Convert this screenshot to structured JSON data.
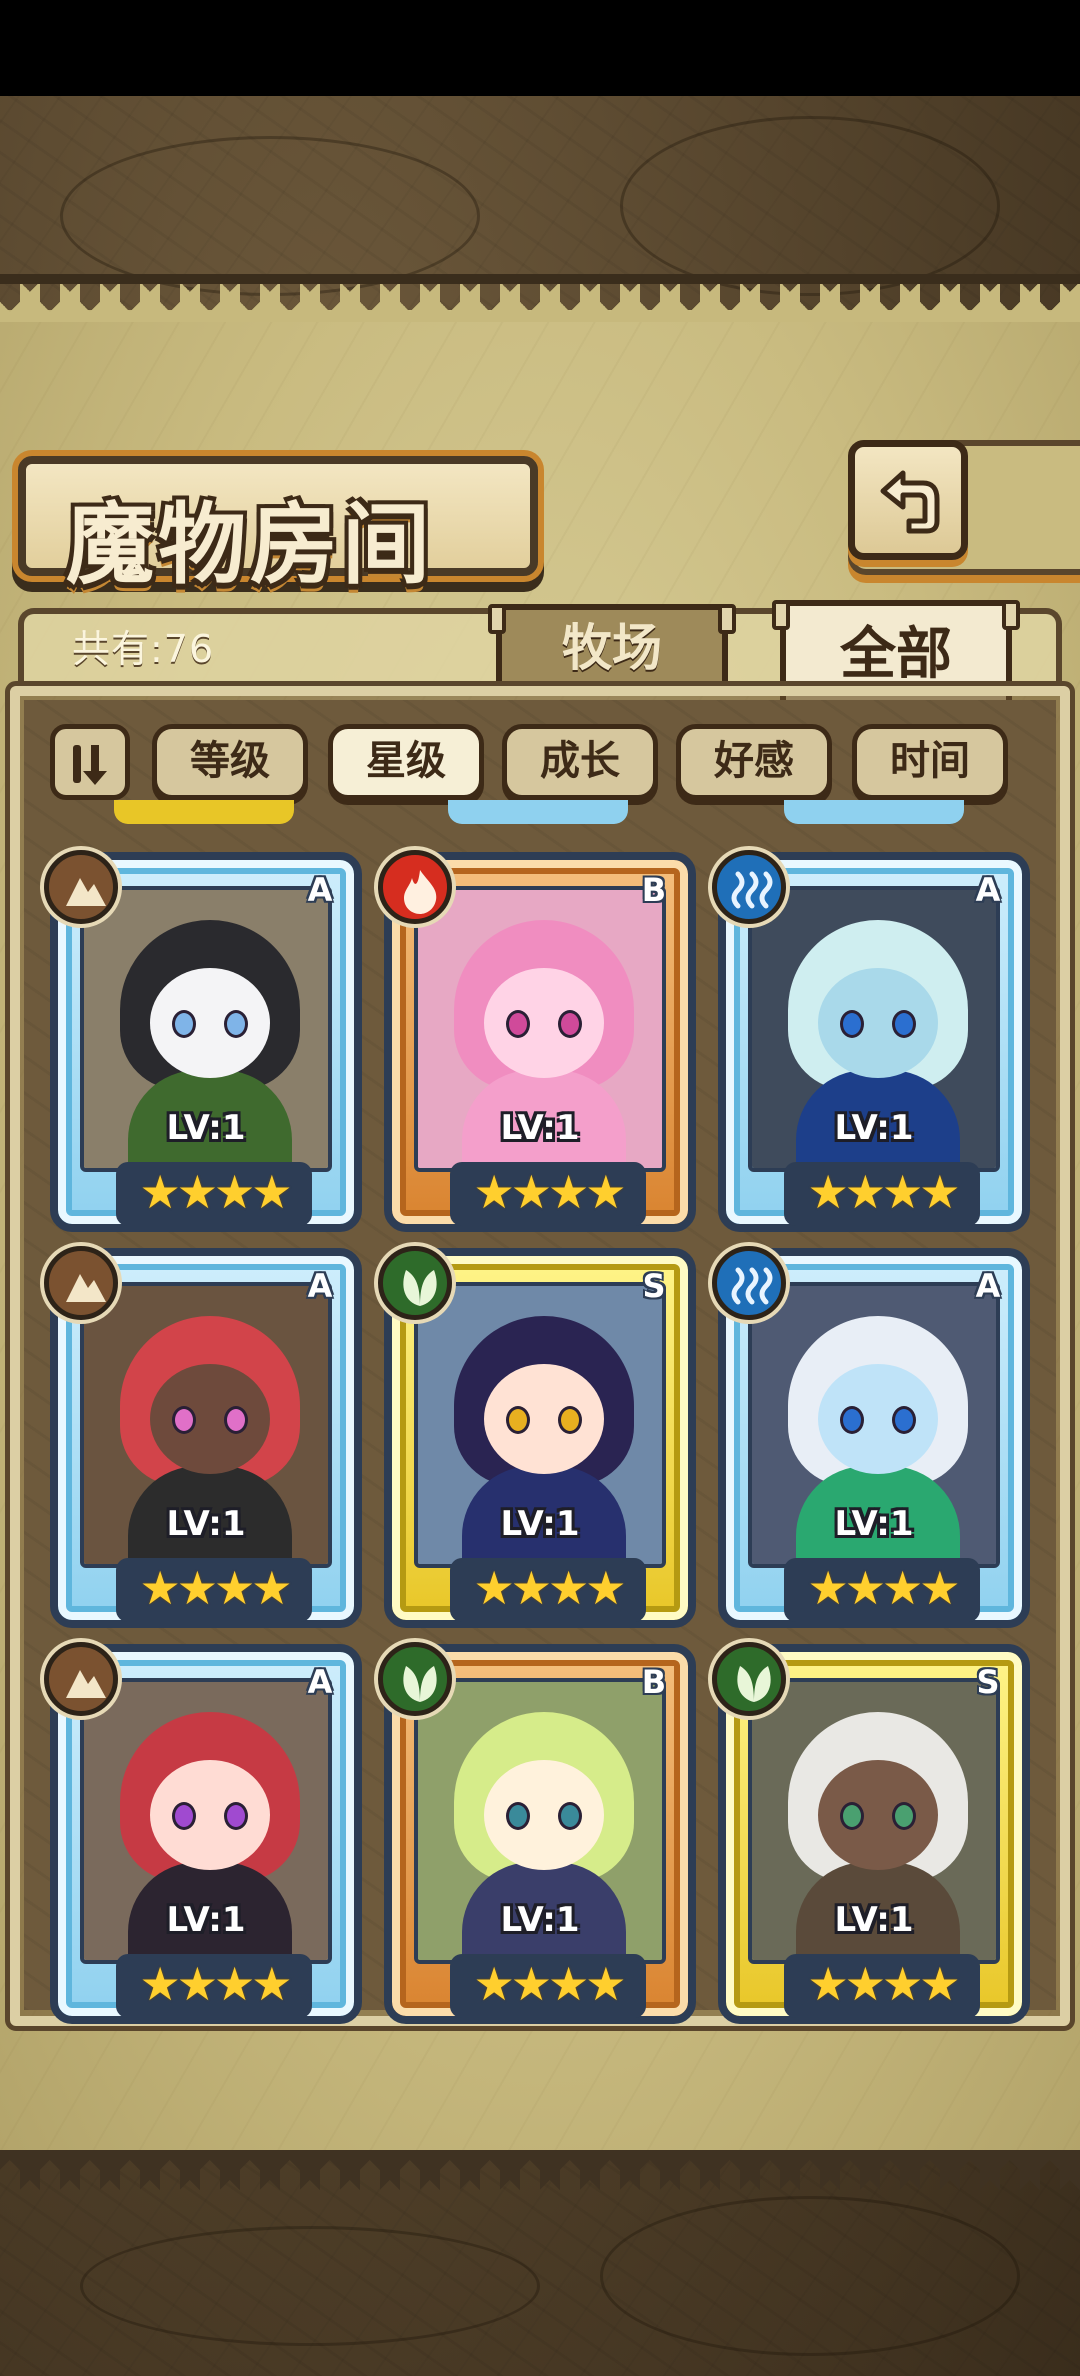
{
  "header": {
    "title": "魔物房间",
    "back_icon": "back-arrow-icon"
  },
  "summary": {
    "count_label": "共有:76"
  },
  "tabs": [
    {
      "label": "牧场",
      "active": false
    },
    {
      "label": "全部",
      "active": true
    }
  ],
  "sort": {
    "toggle_icon": "sort-order-icon",
    "options": [
      {
        "label": "等级",
        "active": false
      },
      {
        "label": "星级",
        "active": true
      },
      {
        "label": "成长",
        "active": false
      },
      {
        "label": "好感",
        "active": false
      },
      {
        "label": "时间",
        "active": false
      }
    ]
  },
  "monsters": [
    {
      "rank": "A",
      "element": "earth",
      "level": "LV:1",
      "stars": 4,
      "palette": {
        "bg": "#8a7f6a",
        "hair": "#2a2a2e",
        "face": "#f4f4f6",
        "body": "#3f6a2e",
        "eye": "#7fb4e8"
      }
    },
    {
      "rank": "B",
      "element": "fire",
      "level": "LV:1",
      "stars": 4,
      "palette": {
        "bg": "#e7a8c4",
        "hair": "#f08dc0",
        "face": "#ffd3e6",
        "body": "#f49fcb",
        "eye": "#d04a9a"
      }
    },
    {
      "rank": "A",
      "element": "water",
      "level": "LV:1",
      "stars": 4,
      "palette": {
        "bg": "#3f4b5c",
        "hair": "#cfeef0",
        "face": "#a9d9ea",
        "body": "#1d3f8a",
        "eye": "#2b6fd0"
      }
    },
    {
      "rank": "A",
      "element": "earth",
      "level": "LV:1",
      "stars": 4,
      "palette": {
        "bg": "#6a5440",
        "hair": "#d2444a",
        "face": "#6e4a3c",
        "body": "#2c2c2c",
        "eye": "#e070c8"
      }
    },
    {
      "rank": "S",
      "element": "wood",
      "level": "LV:1",
      "stars": 4,
      "palette": {
        "bg": "#6f89a8",
        "hair": "#2a2452",
        "face": "#ffe2d4",
        "body": "#27306e",
        "eye": "#e8b020"
      }
    },
    {
      "rank": "A",
      "element": "water",
      "level": "LV:1",
      "stars": 4,
      "palette": {
        "bg": "#4f5a73",
        "hair": "#e8eef6",
        "face": "#bfe3f8",
        "body": "#2aa870",
        "eye": "#2b6fd0"
      }
    },
    {
      "rank": "A",
      "element": "earth",
      "level": "LV:1",
      "stars": 4,
      "palette": {
        "bg": "#7a6a5c",
        "hair": "#c63a44",
        "face": "#ffdcd4",
        "body": "#2c2430",
        "eye": "#a04ad0"
      }
    },
    {
      "rank": "B",
      "element": "wood",
      "level": "LV:1",
      "stars": 4,
      "palette": {
        "bg": "#8fa06a",
        "hair": "#d6ec8a",
        "face": "#fff2dc",
        "body": "#3a3e6a",
        "eye": "#3a8a9a"
      }
    },
    {
      "rank": "S",
      "element": "wood",
      "level": "LV:1",
      "stars": 4,
      "palette": {
        "bg": "#6a6a58",
        "hair": "#e9e8e4",
        "face": "#7a5a48",
        "body": "#5a4a3a",
        "eye": "#4aa070"
      }
    }
  ],
  "colors": {
    "earth": "#7b5230",
    "fire": "#d62d1f",
    "water": "#1f6fb8",
    "wood": "#2e6b2a",
    "star": "#ffcf2e"
  }
}
